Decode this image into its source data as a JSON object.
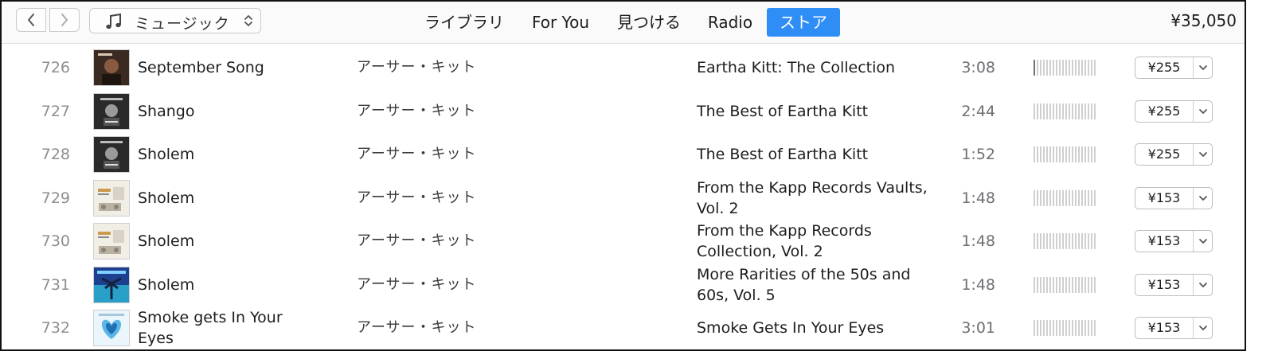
{
  "toolbar": {
    "back_icon": "chevron-left-icon",
    "forward_icon": "chevron-right-icon",
    "media_icon": "music-note-icon",
    "media_label": "ミュージック",
    "tabs": [
      {
        "label": "ライブラリ",
        "active": false
      },
      {
        "label": "For You",
        "active": false
      },
      {
        "label": "見つける",
        "active": false
      },
      {
        "label": "Radio",
        "active": false
      },
      {
        "label": "ストア",
        "active": true
      }
    ],
    "balance": "¥35,050",
    "accent": "#2f8ef5"
  },
  "tracks": [
    {
      "num": "726",
      "title": "September Song",
      "artist": "アーサー・キット",
      "album": "Eartha Kitt: The Collection",
      "time": "3:08",
      "popularity": 0.05,
      "price": "¥255",
      "artwork": "portrait-dark"
    },
    {
      "num": "727",
      "title": "Shango",
      "artist": "アーサー・キット",
      "album": "The Best of Eartha Kitt",
      "time": "2:44",
      "popularity": 0.0,
      "price": "¥255",
      "artwork": "portrait-bw"
    },
    {
      "num": "728",
      "title": "Sholem",
      "artist": "アーサー・キット",
      "album": "The Best of Eartha Kitt",
      "time": "1:52",
      "popularity": 0.0,
      "price": "¥255",
      "artwork": "portrait-bw"
    },
    {
      "num": "729",
      "title": "Sholem",
      "artist": "アーサー・キット",
      "album": "From the Kapp Records Vaults, Vol. 2",
      "time": "1:48",
      "popularity": 0.0,
      "price": "¥153",
      "artwork": "kapp-records"
    },
    {
      "num": "730",
      "title": "Sholem",
      "artist": "アーサー・キット",
      "album": "From the Kapp Records Collection, Vol. 2",
      "time": "1:48",
      "popularity": 0.0,
      "price": "¥153",
      "artwork": "kapp-records"
    },
    {
      "num": "731",
      "title": "Sholem",
      "artist": "アーサー・キット",
      "album": "More Rarities of the 50s and 60s, Vol. 5",
      "time": "1:48",
      "popularity": 0.0,
      "price": "¥153",
      "artwork": "palm-blue"
    },
    {
      "num": "732",
      "title": "Smoke gets In Your Eyes",
      "artist": "アーサー・キット",
      "album": "Smoke Gets In Your Eyes",
      "time": "3:01",
      "popularity": 0.0,
      "price": "¥153",
      "artwork": "heart-light"
    }
  ]
}
